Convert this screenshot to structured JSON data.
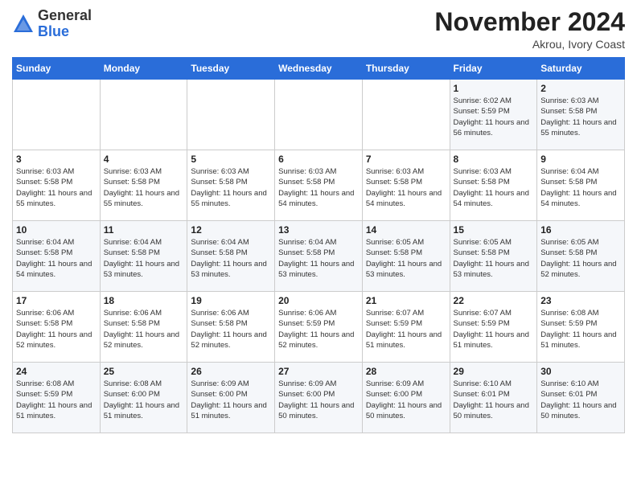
{
  "header": {
    "logo_general": "General",
    "logo_blue": "Blue",
    "month_title": "November 2024",
    "location": "Akrou, Ivory Coast"
  },
  "days_of_week": [
    "Sunday",
    "Monday",
    "Tuesday",
    "Wednesday",
    "Thursday",
    "Friday",
    "Saturday"
  ],
  "weeks": [
    [
      {
        "day": "",
        "info": ""
      },
      {
        "day": "",
        "info": ""
      },
      {
        "day": "",
        "info": ""
      },
      {
        "day": "",
        "info": ""
      },
      {
        "day": "",
        "info": ""
      },
      {
        "day": "1",
        "info": "Sunrise: 6:02 AM\nSunset: 5:59 PM\nDaylight: 11 hours and 56 minutes."
      },
      {
        "day": "2",
        "info": "Sunrise: 6:03 AM\nSunset: 5:58 PM\nDaylight: 11 hours and 55 minutes."
      }
    ],
    [
      {
        "day": "3",
        "info": "Sunrise: 6:03 AM\nSunset: 5:58 PM\nDaylight: 11 hours and 55 minutes."
      },
      {
        "day": "4",
        "info": "Sunrise: 6:03 AM\nSunset: 5:58 PM\nDaylight: 11 hours and 55 minutes."
      },
      {
        "day": "5",
        "info": "Sunrise: 6:03 AM\nSunset: 5:58 PM\nDaylight: 11 hours and 55 minutes."
      },
      {
        "day": "6",
        "info": "Sunrise: 6:03 AM\nSunset: 5:58 PM\nDaylight: 11 hours and 54 minutes."
      },
      {
        "day": "7",
        "info": "Sunrise: 6:03 AM\nSunset: 5:58 PM\nDaylight: 11 hours and 54 minutes."
      },
      {
        "day": "8",
        "info": "Sunrise: 6:03 AM\nSunset: 5:58 PM\nDaylight: 11 hours and 54 minutes."
      },
      {
        "day": "9",
        "info": "Sunrise: 6:04 AM\nSunset: 5:58 PM\nDaylight: 11 hours and 54 minutes."
      }
    ],
    [
      {
        "day": "10",
        "info": "Sunrise: 6:04 AM\nSunset: 5:58 PM\nDaylight: 11 hours and 54 minutes."
      },
      {
        "day": "11",
        "info": "Sunrise: 6:04 AM\nSunset: 5:58 PM\nDaylight: 11 hours and 53 minutes."
      },
      {
        "day": "12",
        "info": "Sunrise: 6:04 AM\nSunset: 5:58 PM\nDaylight: 11 hours and 53 minutes."
      },
      {
        "day": "13",
        "info": "Sunrise: 6:04 AM\nSunset: 5:58 PM\nDaylight: 11 hours and 53 minutes."
      },
      {
        "day": "14",
        "info": "Sunrise: 6:05 AM\nSunset: 5:58 PM\nDaylight: 11 hours and 53 minutes."
      },
      {
        "day": "15",
        "info": "Sunrise: 6:05 AM\nSunset: 5:58 PM\nDaylight: 11 hours and 53 minutes."
      },
      {
        "day": "16",
        "info": "Sunrise: 6:05 AM\nSunset: 5:58 PM\nDaylight: 11 hours and 52 minutes."
      }
    ],
    [
      {
        "day": "17",
        "info": "Sunrise: 6:06 AM\nSunset: 5:58 PM\nDaylight: 11 hours and 52 minutes."
      },
      {
        "day": "18",
        "info": "Sunrise: 6:06 AM\nSunset: 5:58 PM\nDaylight: 11 hours and 52 minutes."
      },
      {
        "day": "19",
        "info": "Sunrise: 6:06 AM\nSunset: 5:58 PM\nDaylight: 11 hours and 52 minutes."
      },
      {
        "day": "20",
        "info": "Sunrise: 6:06 AM\nSunset: 5:59 PM\nDaylight: 11 hours and 52 minutes."
      },
      {
        "day": "21",
        "info": "Sunrise: 6:07 AM\nSunset: 5:59 PM\nDaylight: 11 hours and 51 minutes."
      },
      {
        "day": "22",
        "info": "Sunrise: 6:07 AM\nSunset: 5:59 PM\nDaylight: 11 hours and 51 minutes."
      },
      {
        "day": "23",
        "info": "Sunrise: 6:08 AM\nSunset: 5:59 PM\nDaylight: 11 hours and 51 minutes."
      }
    ],
    [
      {
        "day": "24",
        "info": "Sunrise: 6:08 AM\nSunset: 5:59 PM\nDaylight: 11 hours and 51 minutes."
      },
      {
        "day": "25",
        "info": "Sunrise: 6:08 AM\nSunset: 6:00 PM\nDaylight: 11 hours and 51 minutes."
      },
      {
        "day": "26",
        "info": "Sunrise: 6:09 AM\nSunset: 6:00 PM\nDaylight: 11 hours and 51 minutes."
      },
      {
        "day": "27",
        "info": "Sunrise: 6:09 AM\nSunset: 6:00 PM\nDaylight: 11 hours and 50 minutes."
      },
      {
        "day": "28",
        "info": "Sunrise: 6:09 AM\nSunset: 6:00 PM\nDaylight: 11 hours and 50 minutes."
      },
      {
        "day": "29",
        "info": "Sunrise: 6:10 AM\nSunset: 6:01 PM\nDaylight: 11 hours and 50 minutes."
      },
      {
        "day": "30",
        "info": "Sunrise: 6:10 AM\nSunset: 6:01 PM\nDaylight: 11 hours and 50 minutes."
      }
    ]
  ]
}
